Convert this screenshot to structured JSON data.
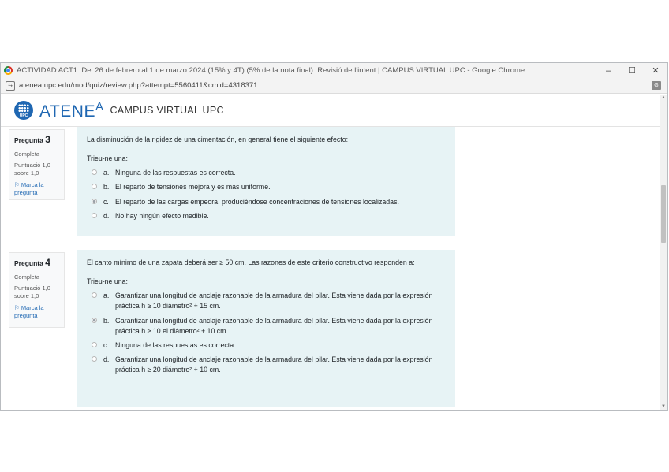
{
  "window": {
    "title": "ACTIVIDAD ACT1. Del 26 de febrero al 1 de marzo 2024 (15% y 4T) (5% de la nota final): Revisió de l'intent | CAMPUS VIRTUAL UPC - Google Chrome",
    "minimize": "–",
    "maximize": "☐",
    "close": "✕"
  },
  "address": {
    "site_icon": "⇆",
    "url": "atenea.upc.edu/mod/quiz/review.php?attempt=5560411&cmid=4318371",
    "translate_icon": "G"
  },
  "header": {
    "logo_text": "UPC",
    "brand_main": "ATENE",
    "brand_sup": "A",
    "campus": "CAMPUS VIRTUAL UPC"
  },
  "questions": [
    {
      "label": "Pregunta",
      "number": "3",
      "state": "Completa",
      "score": "Puntuació 1,0 sobre 1,0",
      "flag": "Marca la pregunta",
      "text": "La disminución de la rigidez de una cimentación, en general tiene el siguiente efecto:",
      "prompt": "Trieu-ne una:",
      "answers": [
        {
          "letter": "a.",
          "text": "Ninguna de las respuestas es correcta.",
          "checked": false
        },
        {
          "letter": "b.",
          "text": "El reparto de tensiones mejora y es más uniforme.",
          "checked": false
        },
        {
          "letter": "c.",
          "text": "El reparto de las cargas empeora, produciéndose concentraciones de tensiones localizadas.",
          "checked": true
        },
        {
          "letter": "d.",
          "text": "No hay ningún efecto medible.",
          "checked": false
        }
      ]
    },
    {
      "label": "Pregunta",
      "number": "4",
      "state": "Completa",
      "score": "Puntuació 1,0 sobre 1,0",
      "flag": "Marca la pregunta",
      "text": "El canto mínimo de una zapata deberá ser ≥ 50 cm. Las razones de este criterio constructivo responden a:",
      "prompt": "Trieu-ne una:",
      "answers": [
        {
          "letter": "a.",
          "text": "Garantizar una longitud de anclaje razonable de la armadura del pilar. Esta viene dada por la expresión práctica h ≥ 10 diámetro² + 15 cm.",
          "checked": false
        },
        {
          "letter": "b.",
          "text": "Garantizar una longitud de anclaje razonable de la armadura del pilar. Esta viene dada por la expresión práctica h ≥ 10 el diámetro² + 10 cm.",
          "checked": true
        },
        {
          "letter": "c.",
          "text": "Ninguna de las respuestas es correcta.",
          "checked": false
        },
        {
          "letter": "d.",
          "text": "Garantizar una longitud de anclaje razonable de la armadura del pilar. Esta viene dada por la expresión práctica h ≥ 20 diámetro² + 10 cm.",
          "checked": false
        }
      ]
    }
  ]
}
